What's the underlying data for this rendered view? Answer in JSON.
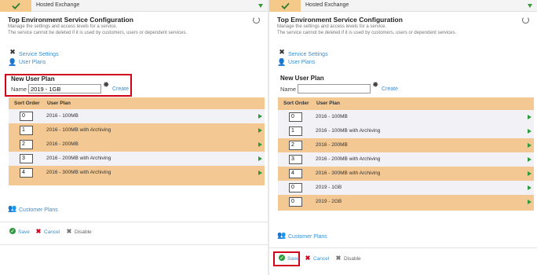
{
  "service_name": "Hosted Exchange",
  "title": "Top Environment Service Configuration",
  "subtitle_1": "Manage the settings and access levels for a service.",
  "subtitle_2": "The service cannot be deleted if it is used by customers, users or dependent services.",
  "links": {
    "service_settings": "Service Settings",
    "user_plans": "User Plans",
    "customer_plans": "Customer Plans"
  },
  "new_user_plan": {
    "heading": "New User Plan",
    "name_label": "Name",
    "create_label": "Create",
    "left_value": "2019 - 1GB",
    "right_value": ""
  },
  "grid": {
    "col_sort": "Sort Order",
    "col_plan": "User Plan"
  },
  "left_rows": [
    {
      "sort": "0",
      "plan": "2016 - 100MB"
    },
    {
      "sort": "1",
      "plan": "2016 - 100MB with Archiving"
    },
    {
      "sort": "2",
      "plan": "2016 - 200MB"
    },
    {
      "sort": "3",
      "plan": "2016 - 200MB with Archiving"
    },
    {
      "sort": "4",
      "plan": "2016 - 300MB with Archiving"
    }
  ],
  "right_rows": [
    {
      "sort": "0",
      "plan": "2016 - 100MB"
    },
    {
      "sort": "1",
      "plan": "2016 - 100MB with Archiving"
    },
    {
      "sort": "2",
      "plan": "2016 - 200MB"
    },
    {
      "sort": "3",
      "plan": "2016 - 200MB with Archiving"
    },
    {
      "sort": "4",
      "plan": "2016 - 300MB with Archiving"
    },
    {
      "sort": "0",
      "plan": "2019 - 1GB"
    },
    {
      "sort": "0",
      "plan": "2019 - 2GB"
    }
  ],
  "actions": {
    "save": "Save",
    "cancel": "Cancel",
    "disable": "Disable"
  },
  "icons": {
    "check": "check-icon",
    "refresh": "refresh-icon",
    "wrench": "wrench-icon",
    "users": "users-icon",
    "gear": "gear-icon",
    "play": "play-arrow-icon"
  },
  "colors": {
    "accent_orange": "#f3c893",
    "highlight_red": "#d0021b",
    "link_blue": "#3a8fcf",
    "ok_green": "#2e9a3e"
  }
}
